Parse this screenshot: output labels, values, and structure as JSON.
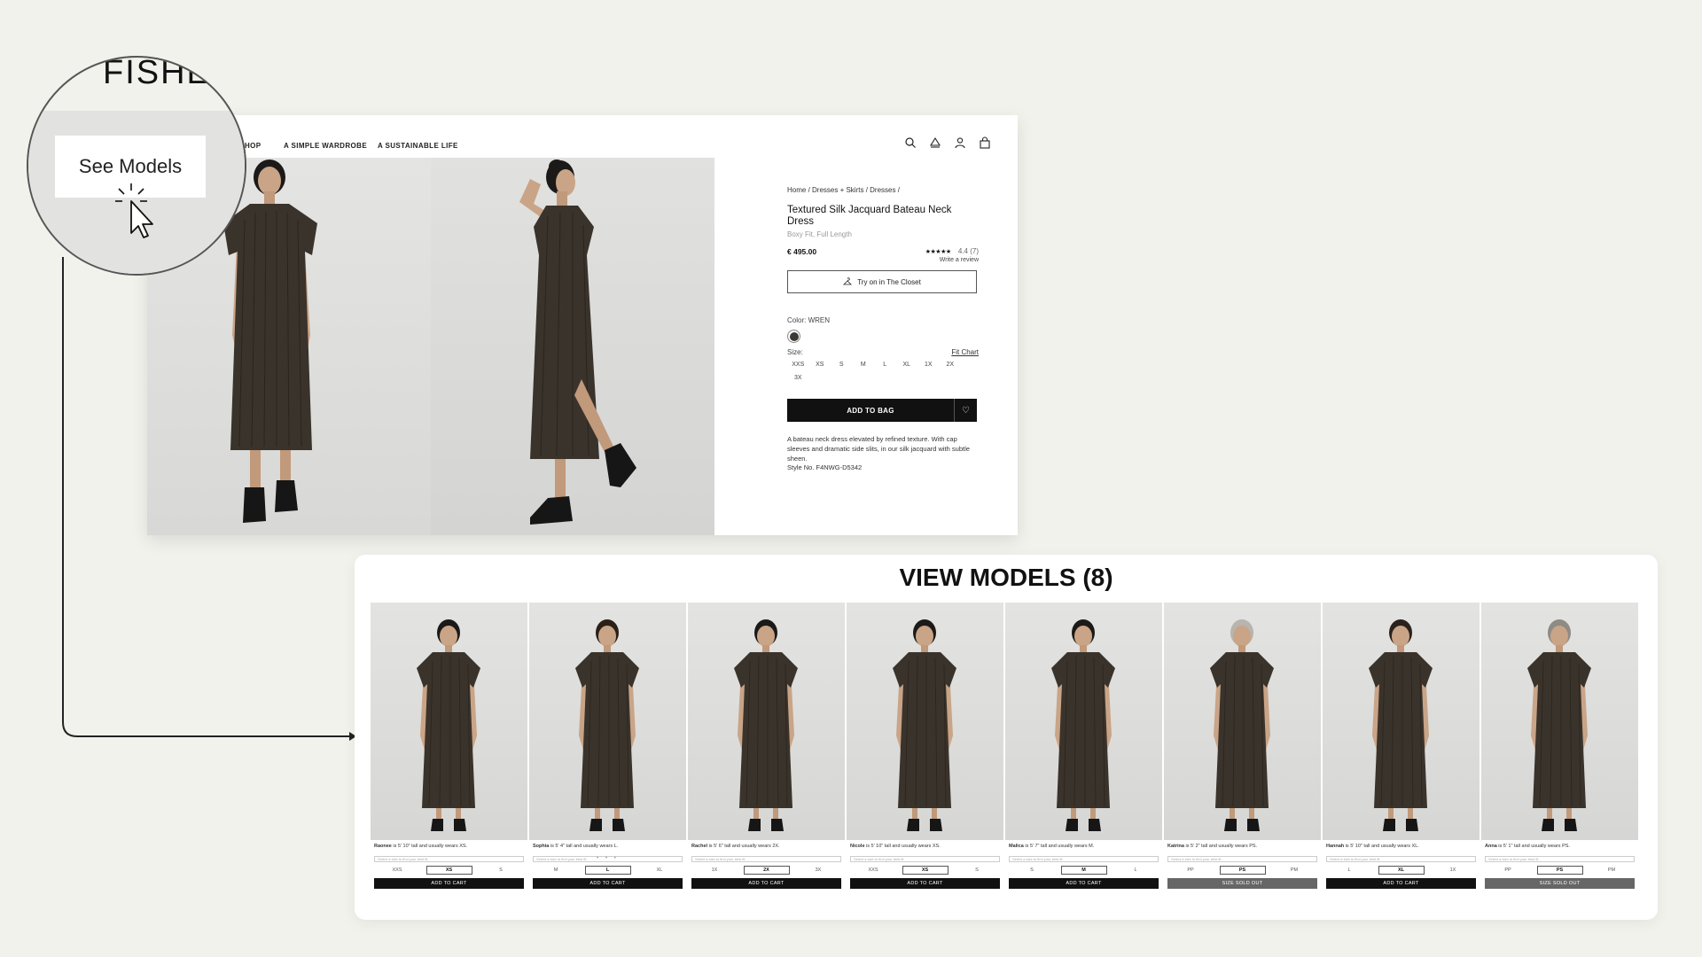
{
  "zoom": {
    "brand_fragment": "FISHE",
    "see_models_label": "See Models"
  },
  "nav": {
    "links": [
      "HOP",
      "A SIMPLE WARDROBE",
      "A SUSTAINABLE LIFE"
    ],
    "icons": [
      "search-icon",
      "stylist-icon",
      "account-icon",
      "bag-icon"
    ]
  },
  "product": {
    "breadcrumb": "Home / Dresses + Skirts / Dresses /",
    "title": "Textured Silk Jacquard Bateau Neck Dress",
    "subtitle": "Boxy Fit, Full Length",
    "price": "€ 495.00",
    "stars": "★★★★★",
    "rating": "4.4 (7)",
    "write_review": "Write a review",
    "try_on_label": "Try on in The Closet",
    "color_label": "Color: WREN",
    "size_label": "Size:",
    "fit_chart": "Fit Chart",
    "sizes": [
      "XXS",
      "XS",
      "S",
      "M",
      "L",
      "XL",
      "1X",
      "2X",
      "3X"
    ],
    "add_to_bag": "ADD TO BAG",
    "description": "A bateau neck dress elevated by refined texture. With cap sleeves and dramatic side slits, in our silk jacquard with subtle sheen.",
    "style_no": "Style No. F4NWG-D5342",
    "swatch_color": "#3d3a35"
  },
  "models_panel": {
    "title": "VIEW MODELS (8)",
    "select_placeholder": "Select a size to find your best fit",
    "models": [
      {
        "name": "Raonee",
        "caption": " is 5' 10\" tall and usually wears XS.",
        "sizes": [
          "XXS",
          "XS",
          "S"
        ],
        "selected": 1,
        "button": "ADD TO CART",
        "sold_out": false
      },
      {
        "name": "Sophia",
        "caption": " is 5' 4\" tall and usually wears L.",
        "sizes": [
          "M",
          "L",
          "XL"
        ],
        "selected": 1,
        "button": "ADD TO CART",
        "sold_out": false
      },
      {
        "name": "Rachel",
        "caption": " is 5' 6\" tall and usually wears 2X.",
        "sizes": [
          "1X",
          "2X",
          "3X"
        ],
        "selected": 1,
        "button": "ADD TO CART",
        "sold_out": false
      },
      {
        "name": "Nicole",
        "caption": " is 5' 10\" tall and usually wears XS.",
        "sizes": [
          "XXS",
          "XS",
          "S"
        ],
        "selected": 1,
        "button": "ADD TO CART",
        "sold_out": false
      },
      {
        "name": "Malica",
        "caption": " is 5' 7\" tall and usually wears M.",
        "sizes": [
          "S",
          "M",
          "L"
        ],
        "selected": 1,
        "button": "ADD TO CART",
        "sold_out": false
      },
      {
        "name": "Katrina",
        "caption": " is 5' 2\" tall and usually wears PS.",
        "sizes": [
          "PP",
          "PS",
          "PM"
        ],
        "selected": 1,
        "button": "SIZE SOLD OUT",
        "sold_out": true
      },
      {
        "name": "Hannah",
        "caption": " is 5' 10\" tall and usually wears XL.",
        "sizes": [
          "L",
          "XL",
          "1X"
        ],
        "selected": 1,
        "button": "ADD TO CART",
        "sold_out": false
      },
      {
        "name": "Anna",
        "caption": " is 5' 1\" tall and usually wears PS.",
        "sizes": [
          "PP",
          "PS",
          "PM"
        ],
        "selected": 1,
        "button": "SIZE SOLD OUT",
        "sold_out": true
      }
    ],
    "pager_dots": "• • •"
  },
  "colors": {
    "dress": "#3a332b",
    "skin": "#c9a487",
    "hair": "#1c1a18",
    "boots": "#161616"
  }
}
